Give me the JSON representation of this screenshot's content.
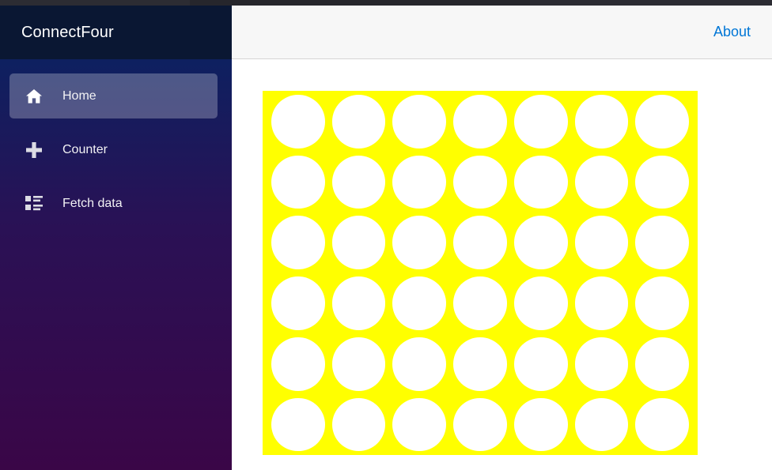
{
  "browser": {
    "chrome_strip_color": "#2c2c33",
    "tabstrip_color": "#26262c"
  },
  "sidebar": {
    "brand": {
      "title": "ConnectFour",
      "background_color": "#0a1733"
    },
    "gradient_from": "#081a3c",
    "gradient_to": "#3a0647",
    "items": [
      {
        "label": "Home",
        "icon": "home-icon",
        "active": true
      },
      {
        "label": "Counter",
        "icon": "plus-icon",
        "active": false
      },
      {
        "label": "Fetch data",
        "icon": "list-rich-icon",
        "active": false
      }
    ]
  },
  "header": {
    "about_label": "About",
    "about_link_color": "#0076d6",
    "background_color": "#f7f7f7"
  },
  "board": {
    "columns": 7,
    "rows": 6,
    "board_color": "#ffff00",
    "empty_cell_color": "#ffffff",
    "player_one_color": "#e01b24",
    "player_two_color": "#f6d32d",
    "cells": [
      [
        "empty",
        "empty",
        "empty",
        "empty",
        "empty",
        "empty",
        "empty"
      ],
      [
        "empty",
        "empty",
        "empty",
        "empty",
        "empty",
        "empty",
        "empty"
      ],
      [
        "empty",
        "empty",
        "empty",
        "empty",
        "empty",
        "empty",
        "empty"
      ],
      [
        "empty",
        "empty",
        "empty",
        "empty",
        "empty",
        "empty",
        "empty"
      ],
      [
        "empty",
        "empty",
        "empty",
        "empty",
        "empty",
        "empty",
        "empty"
      ],
      [
        "empty",
        "empty",
        "empty",
        "empty",
        "empty",
        "empty",
        "empty"
      ]
    ]
  }
}
